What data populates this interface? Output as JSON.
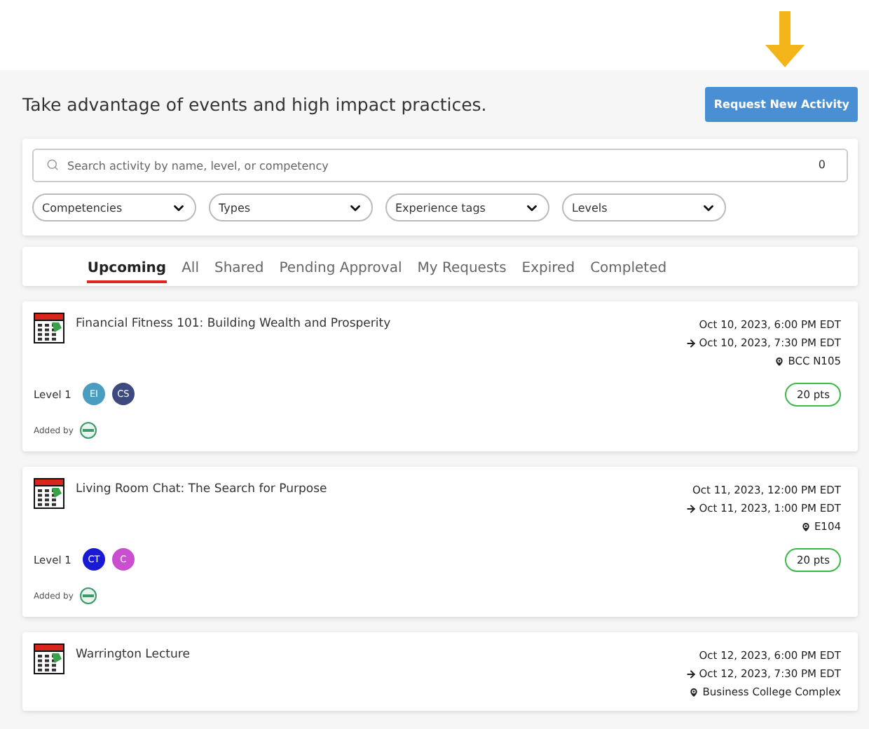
{
  "header": {
    "intro": "Take advantage of events and high impact practices.",
    "request_button": "Request New Activity"
  },
  "filters": {
    "search": {
      "placeholder": "Search activity by name, level, or competency",
      "count": "0"
    },
    "dropdowns": [
      "Competencies",
      "Types",
      "Experience tags",
      "Levels"
    ]
  },
  "tabs": [
    {
      "label": "Upcoming",
      "selected": true
    },
    {
      "label": "All",
      "selected": false
    },
    {
      "label": "Shared",
      "selected": false
    },
    {
      "label": "Pending Approval",
      "selected": false
    },
    {
      "label": "My Requests",
      "selected": false
    },
    {
      "label": "Expired",
      "selected": false
    },
    {
      "label": "Completed",
      "selected": false
    }
  ],
  "activities": [
    {
      "title": "Financial Fitness 101: Building Wealth and Prosperity",
      "start": "Oct 10, 2023, 6:00 PM EDT",
      "end": "Oct 10, 2023, 7:30 PM EDT",
      "location": "BCC N105",
      "level": "Level 1",
      "competencies": [
        {
          "initials": "EI",
          "color": "#4a9cc0"
        },
        {
          "initials": "CS",
          "color": "#3d4a7f"
        }
      ],
      "points": "20 pts",
      "added_by": "Added by"
    },
    {
      "title": "Living Room Chat: The Search for Purpose",
      "start": "Oct 11, 2023, 12:00 PM EDT",
      "end": "Oct 11, 2023, 1:00 PM EDT",
      "location": "E104",
      "level": "Level 1",
      "competencies": [
        {
          "initials": "CT",
          "color": "#1a1ad6"
        },
        {
          "initials": "C",
          "color": "#c94fcf"
        }
      ],
      "points": "20 pts",
      "added_by": "Added by"
    },
    {
      "title": "Warrington Lecture",
      "start": "Oct 12, 2023, 6:00 PM EDT",
      "end": "Oct 12, 2023, 7:30 PM EDT",
      "location": "Business College Complex"
    }
  ]
}
